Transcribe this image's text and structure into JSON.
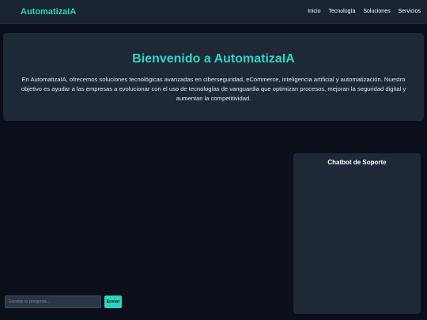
{
  "header": {
    "brand": "AutomatizaIA",
    "nav": [
      "Inicio",
      "Tecnología",
      "Soluciones",
      "Servicios"
    ]
  },
  "hero": {
    "title": "Bienvenido a AutomatizaIA",
    "text": "En AutomatizaIA, ofrecemos soluciones tecnológicas avanzadas en ciberseguridad, eCommerce, inteligencia artificial y automatización. Nuestro objetivo es ayudar a las empresas a evolucionar con el uso de tecnologías de vanguardia que optimizan procesos, mejoran la seguridad digital y aumentan la competitividad."
  },
  "chat": {
    "title": "Chatbot de Soporte",
    "input_placeholder": "Escribe tu pregunta...",
    "send_label": "Enviar"
  },
  "colors": {
    "accent": "#2dd4bf",
    "background": "#0a0f1a",
    "panel": "#1e2938"
  }
}
